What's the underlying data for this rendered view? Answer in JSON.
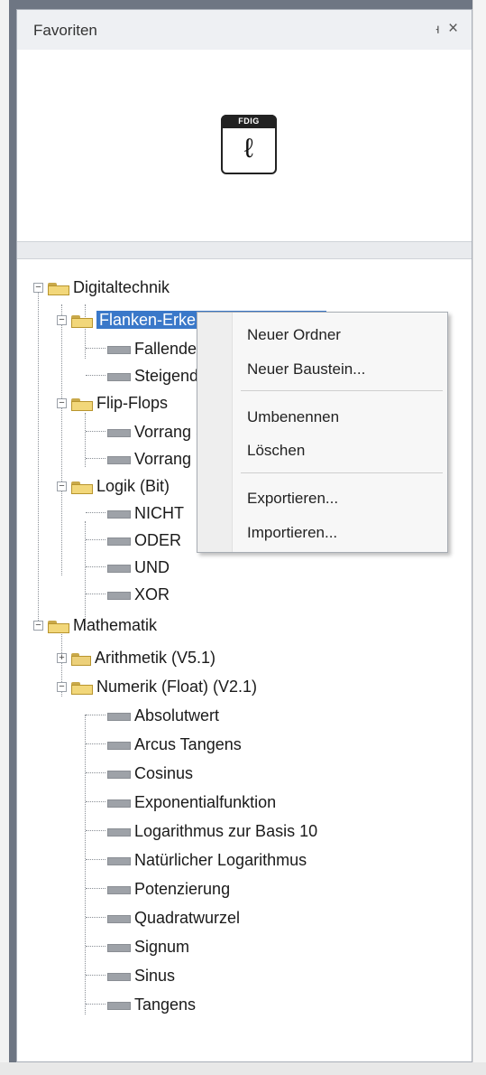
{
  "panel": {
    "title": "Favoriten",
    "pin_glyph": "ᅥ",
    "close_glyph": "×"
  },
  "preview": {
    "block_tag": "FDIG",
    "block_glyph": "ℓ"
  },
  "tree": {
    "digitaltechnik": "Digitaltechnik",
    "flanken": "Flanken-Erkennung (Bit) (V1.1)",
    "fallend": "Fallende Flanke",
    "steigend": "Steigende Flanke",
    "flipflop": "Flip-Flops",
    "vorrang1": "Vorrang Setzen",
    "vorrang2": "Vorrang Rücksetzen",
    "logik": "Logik (Bit)",
    "nicht": "NICHT",
    "oder": "ODER",
    "und": "UND",
    "xor": "XOR",
    "mathematik": "Mathematik",
    "arithmetik": "Arithmetik (V5.1)",
    "numerik": "Numerik (Float) (V2.1)",
    "numerik_items": [
      "Absolutwert",
      "Arcus Tangens",
      "Cosinus",
      "Exponentialfunktion",
      "Logarithmus zur Basis 10",
      "Natürlicher Logarithmus",
      "Potenzierung",
      "Quadratwurzel",
      "Signum",
      "Sinus",
      "Tangens"
    ]
  },
  "context_menu": {
    "new_folder": "Neuer Ordner",
    "new_block": "Neuer Baustein...",
    "rename": "Umbenennen",
    "delete": "Löschen",
    "export": "Exportieren...",
    "import": "Importieren..."
  },
  "colors": {
    "selection": "#3a78c9",
    "chrome_dark": "#6e7683"
  }
}
